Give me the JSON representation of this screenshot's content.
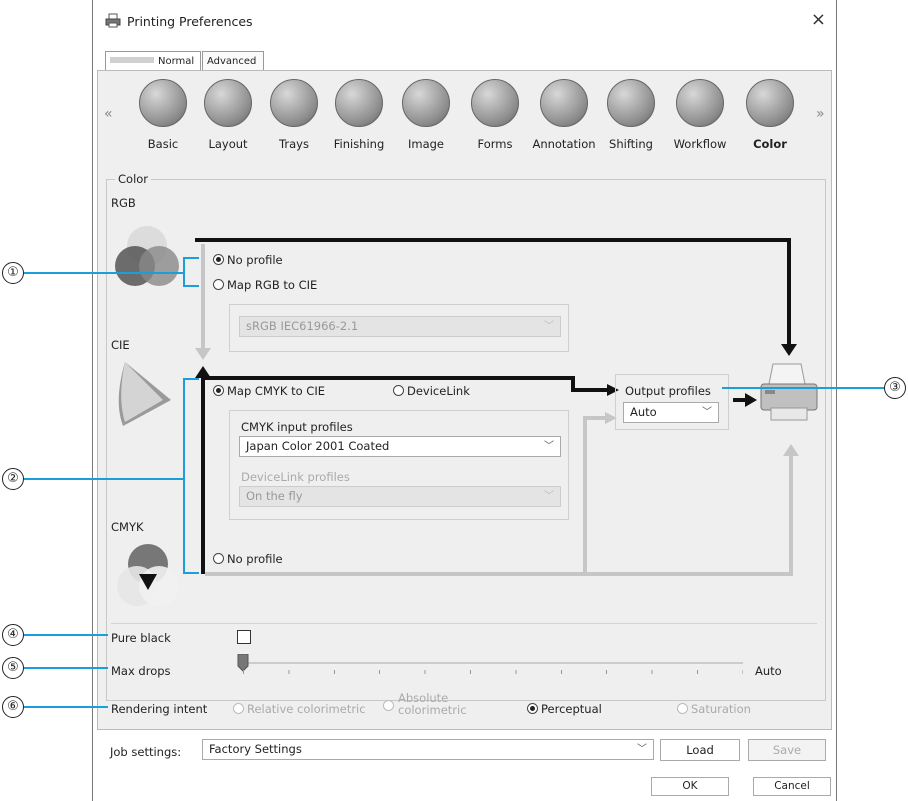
{
  "window": {
    "title": "Printing Preferences",
    "close_glyph": "×"
  },
  "tabs": [
    {
      "label": "Normal"
    },
    {
      "label": "Advanced"
    }
  ],
  "toolbar": {
    "prev_glyph": "«",
    "next_glyph": "»",
    "items": [
      {
        "label": "Basic"
      },
      {
        "label": "Layout"
      },
      {
        "label": "Trays"
      },
      {
        "label": "Finishing"
      },
      {
        "label": "Image"
      },
      {
        "label": "Forms"
      },
      {
        "label": "Annotation"
      },
      {
        "label": "Shifting"
      },
      {
        "label": "Workflow"
      },
      {
        "label": "Color"
      }
    ],
    "active": "Color"
  },
  "color": {
    "group_label": "Color",
    "rgb_label": "RGB",
    "cie_label": "CIE",
    "cmyk_label": "CMYK",
    "rgb_no_profile": "No profile",
    "rgb_map": "Map RGB to CIE",
    "rgb_profile_value": "sRGB IEC61966-2.1",
    "map_cmyk": "Map CMYK to CIE",
    "devicelink": "DeviceLink",
    "cmyk_input_label": "CMYK input profiles",
    "cmyk_input_value": "Japan Color 2001 Coated",
    "devicelink_profiles_label": "DeviceLink profiles",
    "devicelink_profiles_value": "On the fly",
    "cmyk_no_profile": "No profile",
    "output_profiles_label": "Output profiles",
    "output_profiles_value": "Auto"
  },
  "settings": {
    "pure_black_label": "Pure black",
    "pure_black_checked": false,
    "max_drops_label": "Max drops",
    "max_drops_end": "Auto",
    "rendering_intent_label": "Rendering intent",
    "intents": [
      {
        "label": "Relative colorimetric",
        "enabled": false
      },
      {
        "label": "Absolute colorimetric",
        "enabled": false
      },
      {
        "label": "Perceptual",
        "enabled": true,
        "selected": true
      },
      {
        "label": "Saturation",
        "enabled": false
      }
    ]
  },
  "job": {
    "label": "Job settings:",
    "value": "Factory Settings",
    "load": "Load",
    "save": "Save"
  },
  "footer": {
    "ok": "OK",
    "cancel": "Cancel"
  },
  "callouts": [
    "①",
    "②",
    "③",
    "④",
    "⑤",
    "⑥"
  ],
  "colors": {
    "callout_line": "#1c9fd8",
    "flow_active": "#111111",
    "flow_inactive": "#c6c6c6"
  },
  "icons": [
    "printer-icon",
    "basic-icon",
    "layout-icon",
    "trays-icon",
    "finishing-icon",
    "image-icon",
    "forms-icon",
    "annotation-icon",
    "shifting-icon",
    "workflow-icon",
    "color-icon",
    "rgb-venn-icon",
    "cie-gamut-icon",
    "cmyk-venn-icon",
    "output-printer-icon"
  ]
}
